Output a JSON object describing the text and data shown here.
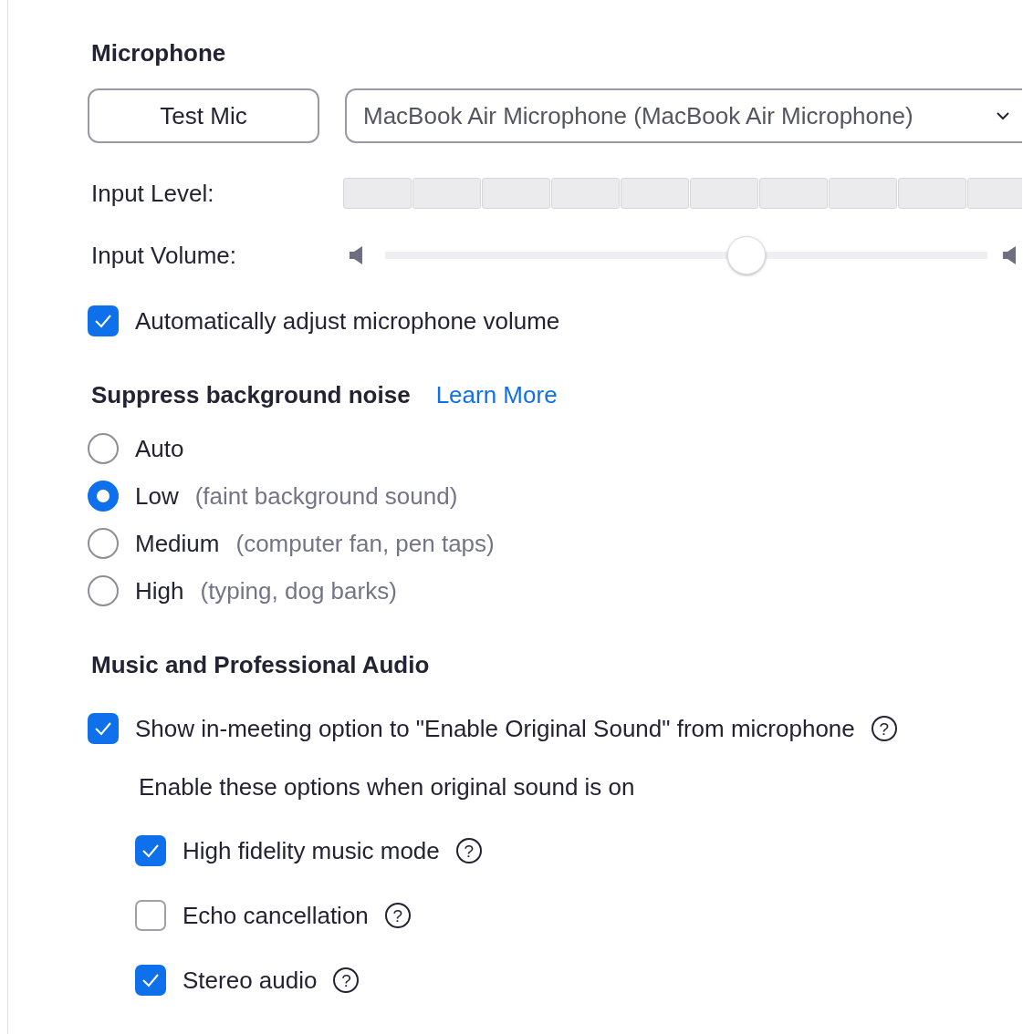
{
  "microphone": {
    "title": "Microphone",
    "test_button": "Test Mic",
    "device_select": {
      "value": "MacBook Air Microphone (MacBook Air Microphone)"
    },
    "input_level": {
      "label": "Input Level:"
    },
    "input_volume": {
      "label": "Input Volume:",
      "level": 0.6
    },
    "auto_adjust": {
      "label": "Automatically adjust microphone volume",
      "checked": true
    }
  },
  "noise": {
    "title": "Suppress background noise",
    "link": "Learn More",
    "options": [
      {
        "label": "Auto",
        "selected": false
      },
      {
        "label": "Low",
        "hint": "(faint background sound)",
        "selected": true
      },
      {
        "label": "Medium",
        "hint": "(computer fan, pen taps)",
        "selected": false
      },
      {
        "label": "High",
        "hint": "(typing, dog barks)",
        "selected": false
      }
    ]
  },
  "music": {
    "title": "Music and Professional Audio",
    "original_sound": {
      "label": "Show in-meeting option to \"Enable Original Sound\" from microphone",
      "checked": true,
      "help": "?"
    },
    "subtitle": "Enable these options when original sound is on",
    "options": [
      {
        "label": "High fidelity music mode",
        "checked": true,
        "help": "?"
      },
      {
        "label": "Echo cancellation",
        "checked": false,
        "help": "?"
      },
      {
        "label": "Stereo audio",
        "checked": true,
        "help": "?"
      }
    ]
  }
}
